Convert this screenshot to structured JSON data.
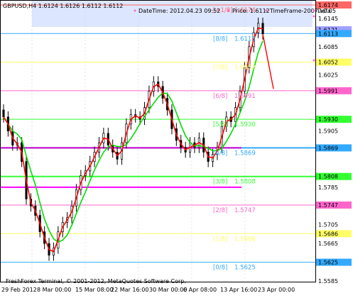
{
  "window": {
    "symbol_header": "GBPUSD,H4  1.6124 1.6126 1.6112 1.6112",
    "terminal_footer": "FreshForex Terminal, © 2001-2012, MetaQuotes Software Corp."
  },
  "info_bar": {
    "datetime_label": "DateTime: 2012.04.23 09:52",
    "price_label": "Price: 1.6112",
    "timeframe_label": "TimeFrame-2007-v0.05",
    "default_label": "Defa"
  },
  "colors": {
    "background": "#ffffff",
    "axis": "#000000",
    "grid": "#c8d0e0",
    "candle": "#000000",
    "ma_fast": "#ff0000",
    "ma_slow": "#00dd00",
    "mm_plus1": "#ff6666",
    "mm_8": "#33aaff",
    "mm_7": "#ffff66",
    "mm_6": "#ff66cc",
    "mm_5": "#33ff33",
    "mm_4": "#33aaff",
    "mm_3": "#33ff33",
    "mm_2": "#ff66cc",
    "mm_1": "#ffff66",
    "mm_0": "#33aaff",
    "highlight_blue": "#dde6ff"
  },
  "chart_data": {
    "type": "candlestick",
    "title": "GBPUSD,H4",
    "ylim": [
      1.5585,
      1.6174
    ],
    "price_ticks": [
      "1.6174",
      "1.6121",
      "1.6113",
      "1.6112",
      "1.6125",
      "1.6052",
      "1.5991",
      "1.5930",
      "1.5869",
      "1.5808",
      "1.5747",
      "1.5686",
      "1.5625",
      "1.6115",
      "1.6085",
      "1.6060",
      "1.6030",
      "1.6010",
      "1.5950",
      "1.5910",
      "1.5890",
      "1.5850",
      "1.5830",
      "1.5790",
      "1.5770",
      "1.5730",
      "1.5705",
      "1.5665",
      "1.5645",
      "1.5605",
      "1.5585"
    ],
    "price_axis_labels": [
      {
        "text": "1.6174",
        "value": 1.6174,
        "boxed": true,
        "color": "#ff6666"
      },
      {
        "text": "1.6145",
        "value": 1.6145
      },
      {
        "text": "1.6121",
        "value": 1.6121,
        "boxed": true,
        "color": "#a0a0ff"
      },
      {
        "text": "1.6113",
        "value": 1.6113,
        "boxed": true,
        "color": "#33aaff"
      },
      {
        "text": "1.6085",
        "value": 1.6085
      },
      {
        "text": "1.6052",
        "value": 1.6052,
        "boxed": true,
        "color": "#ffff66"
      },
      {
        "text": "1.6025",
        "value": 1.6025
      },
      {
        "text": "1.5991",
        "value": 1.5991,
        "boxed": true,
        "color": "#ff66cc"
      },
      {
        "text": "1.5930",
        "value": 1.593,
        "boxed": true,
        "color": "#33ff33"
      },
      {
        "text": "1.5905",
        "value": 1.5905
      },
      {
        "text": "1.5869",
        "value": 1.5869,
        "boxed": true,
        "color": "#33aaff"
      },
      {
        "text": "1.5808",
        "value": 1.5808,
        "boxed": true,
        "color": "#33ff33"
      },
      {
        "text": "1.5785",
        "value": 1.5785
      },
      {
        "text": "1.5747",
        "value": 1.5747,
        "boxed": true,
        "color": "#ff66cc"
      },
      {
        "text": "1.5705",
        "value": 1.5705
      },
      {
        "text": "1.5686",
        "value": 1.5686,
        "boxed": true,
        "color": "#ffff66"
      },
      {
        "text": "1.5665",
        "value": 1.5665
      },
      {
        "text": "1.5625",
        "value": 1.5625,
        "boxed": true,
        "color": "#33aaff"
      },
      {
        "text": "1.5585",
        "value": 1.5585
      }
    ],
    "time_axis_labels": [
      "29 Feb 2012",
      "8 Mar 00:00",
      "15 Mar 08:00",
      "22 Mar 16:00",
      "30 Mar 00:00",
      "6 Apr 08:00",
      "13 Apr 16:00",
      "23 Apr 00:00"
    ],
    "murrey_levels": [
      {
        "label": "[+1/8]",
        "value": 1.6174,
        "text": "1.6174",
        "color": "#ff6666"
      },
      {
        "label": "[8/8]",
        "value": 1.6113,
        "text": "1.6113",
        "color": "#33aaff"
      },
      {
        "label": "[7/8]",
        "value": 1.6052,
        "text": "1.6052",
        "color": "#ffff66"
      },
      {
        "label": "[6/8]",
        "value": 1.5991,
        "text": "1.5991",
        "color": "#ff66cc"
      },
      {
        "label": "[5/8]",
        "value": 1.593,
        "text": "1.5930",
        "color": "#33ff33"
      },
      {
        "label": "[4/8]",
        "value": 1.5869,
        "text": "1.5869",
        "color": "#33aaff"
      },
      {
        "label": "[3/8]",
        "value": 1.5808,
        "text": "1.5808",
        "color": "#33ff33"
      },
      {
        "label": "[2/8]",
        "value": 1.5747,
        "text": "1.5747",
        "color": "#ff66cc"
      },
      {
        "label": "[1/8]",
        "value": 1.5686,
        "text": "1.5686",
        "color": "#ffff66"
      },
      {
        "label": "[0/8]",
        "value": 1.5625,
        "text": "1.5625",
        "color": "#33aaff"
      }
    ],
    "close_series": [
      1.5935,
      1.5905,
      1.5875,
      1.588,
      1.584,
      1.576,
      1.5745,
      1.5725,
      1.569,
      1.5665,
      1.564,
      1.5655,
      1.569,
      1.571,
      1.572,
      1.5745,
      1.578,
      1.581,
      1.582,
      1.584,
      1.586,
      1.588,
      1.59,
      1.5875,
      1.586,
      1.5845,
      1.588,
      1.592,
      1.594,
      1.5935,
      1.593,
      1.5955,
      1.599,
      1.601,
      1.6,
      1.5975,
      1.595,
      1.591,
      1.5885,
      1.587,
      1.586,
      1.588,
      1.587,
      1.589,
      1.586,
      1.584,
      1.5855,
      1.587,
      1.5915,
      1.5935,
      1.5925,
      1.5955,
      1.599,
      1.604,
      1.6085,
      1.6115,
      1.6135,
      1.6112
    ]
  }
}
